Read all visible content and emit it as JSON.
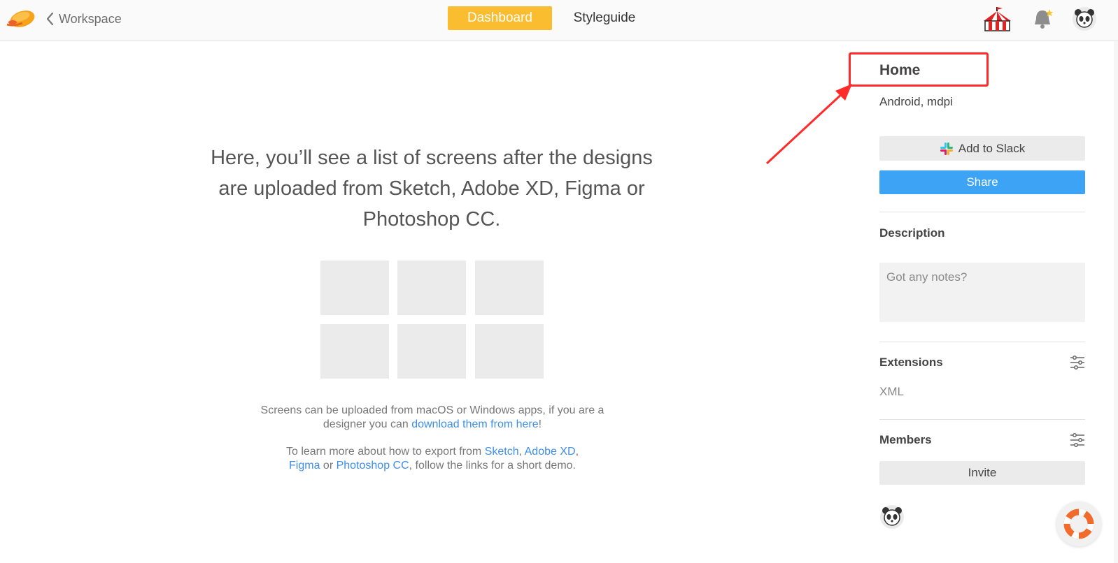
{
  "header": {
    "back_label": "Workspace",
    "tabs": [
      {
        "label": "Dashboard",
        "active": true
      },
      {
        "label": "Styleguide",
        "active": false
      }
    ],
    "accent_color": "#fbbd30"
  },
  "main": {
    "headline": "Here, you’ll see a list of screens after the designs are uploaded from Sketch, Adobe XD, Figma or Photoshop CC.",
    "note1": {
      "text_before": "Screens can be uploaded from macOS or Windows apps, if you are a designer you can ",
      "link": "download them from here",
      "text_after": "!"
    },
    "note2": {
      "text_before": "To learn more about how to export from ",
      "link_sketch": "Sketch",
      "sep1": ", ",
      "link_xd": "Adobe XD",
      "sep2": ", ",
      "link_figma": "Figma",
      "sep3": " or ",
      "link_photoshop": "Photoshop CC",
      "text_after": ", follow the links for a short demo."
    },
    "link_color": "#3d8fe8"
  },
  "panel": {
    "title": "Home",
    "subtitle": "Android, mdpi",
    "add_to_slack_label": "Add to Slack",
    "share_label": "Share",
    "share_color": "#3da4f5",
    "description_title": "Description",
    "notes_placeholder": "Got any notes?",
    "extensions_title": "Extensions",
    "extensions": [
      "XML"
    ],
    "members_title": "Members",
    "invite_label": "Invite"
  },
  "annotation": {
    "color": "#ff2a2a"
  },
  "icons": [
    "zeplin-logo-icon",
    "chevron-left-icon",
    "circus-tent-icon",
    "bell-icon",
    "panda-avatar-icon",
    "slack-icon",
    "settings-sliders-icon",
    "lifebuoy-icon"
  ]
}
